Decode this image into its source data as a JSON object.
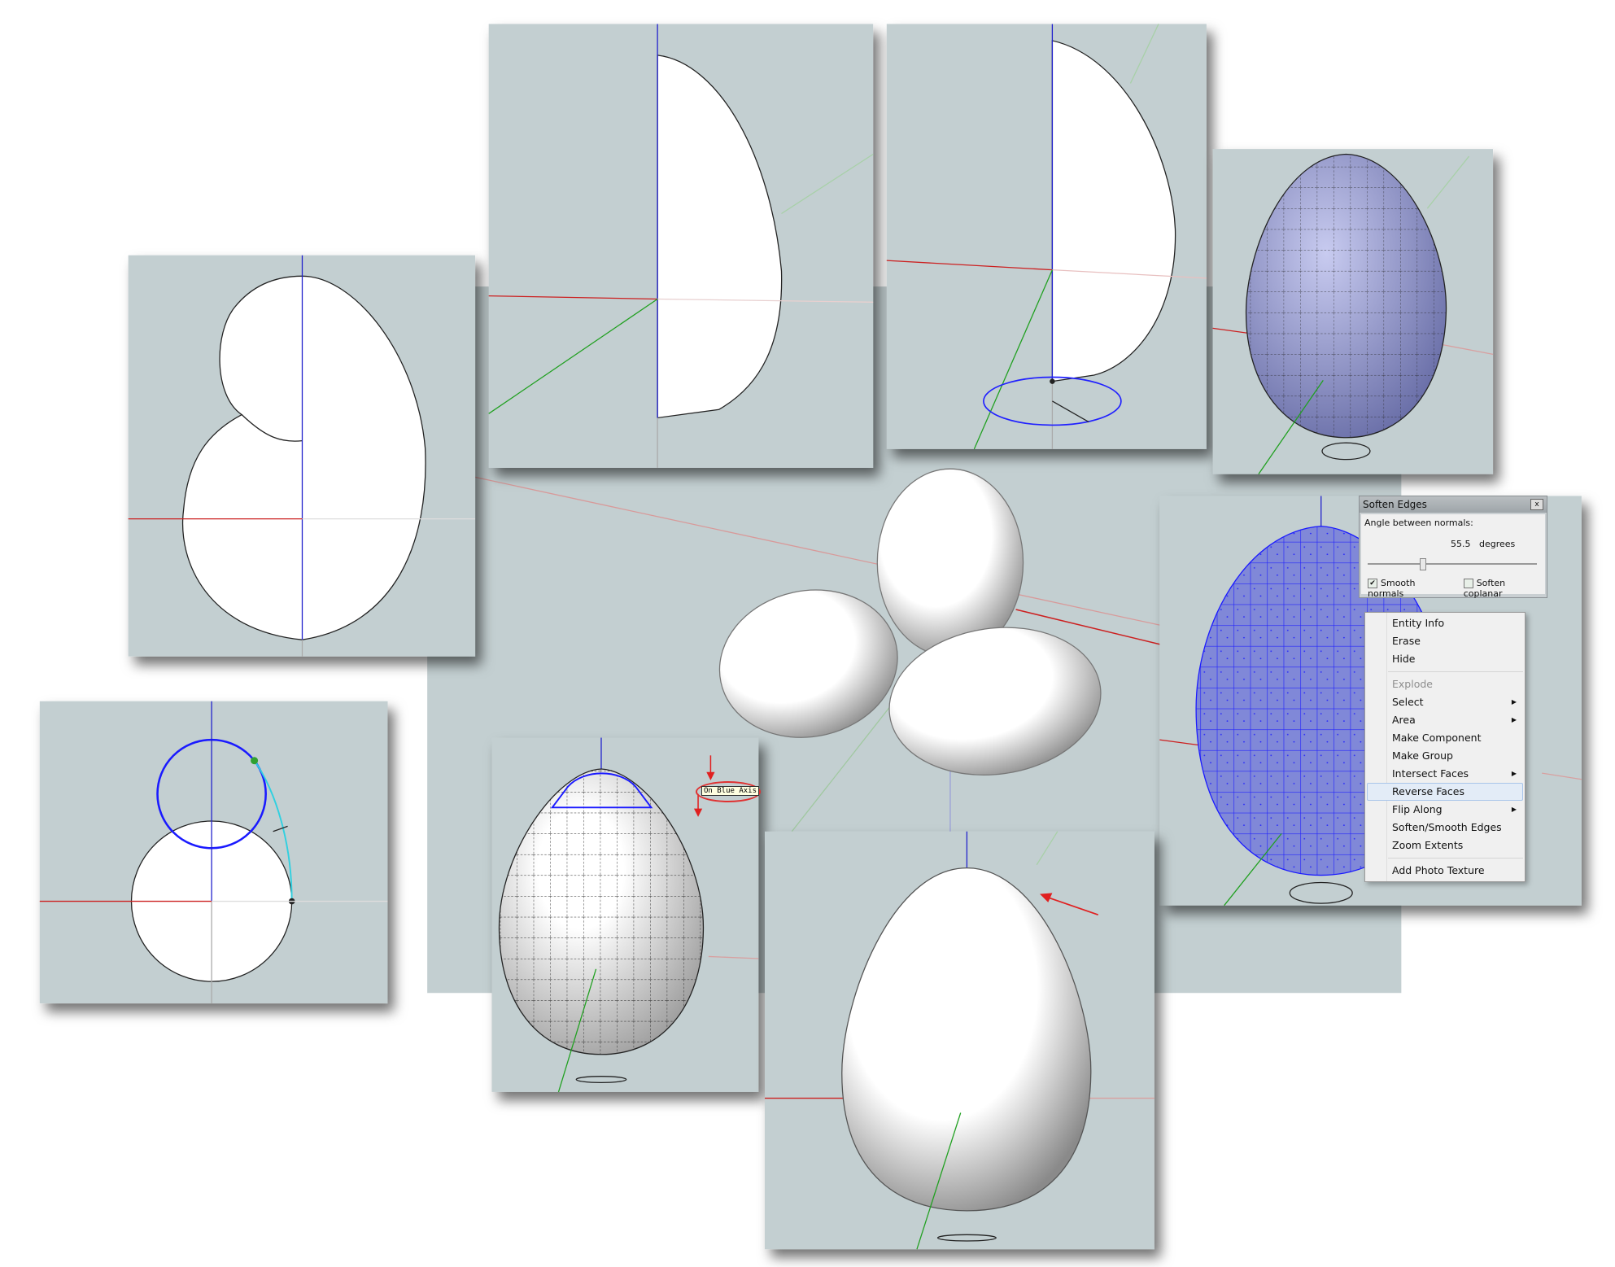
{
  "soften_dialog": {
    "title": "Soften Edges",
    "close_label": "x",
    "angle_label": "Angle between normals:",
    "angle_value": "55.5",
    "angle_unit": "degrees",
    "slider_fraction": 0.31,
    "smooth_normals_label": "Smooth normals",
    "smooth_normals_checked": true,
    "soften_coplanar_label": "Soften coplanar",
    "soften_coplanar_checked": false
  },
  "context_menu": {
    "items": [
      {
        "label": "Entity Info"
      },
      {
        "label": "Erase"
      },
      {
        "label": "Hide"
      },
      {
        "label": "Explode",
        "disabled": true
      },
      {
        "label": "Select",
        "submenu": true
      },
      {
        "label": "Area",
        "submenu": true
      },
      {
        "label": "Make Component"
      },
      {
        "label": "Make Group"
      },
      {
        "label": "Intersect Faces",
        "submenu": true
      },
      {
        "label": "Reverse Faces",
        "highlighted": true
      },
      {
        "label": "Flip Along",
        "submenu": true
      },
      {
        "label": "Soften/Smooth Edges"
      },
      {
        "label": "Zoom Extents"
      },
      {
        "label": "Add Photo Texture"
      }
    ]
  },
  "inference_tooltip": "On Blue Axis",
  "colors": {
    "viewport_bg": "#c3cfd1",
    "red_axis": "#cc2020",
    "green_axis": "#20a020",
    "blue_axis": "#2020cc",
    "mesh_blue": "#9aa0d8",
    "selection_blue": "#1a1aff"
  }
}
